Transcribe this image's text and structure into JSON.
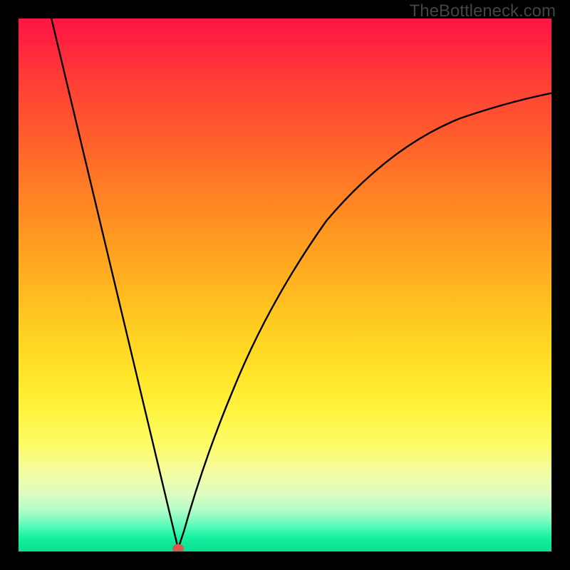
{
  "watermark": "TheBottleneck.com",
  "chart_data": {
    "type": "line",
    "title": "",
    "xlabel": "",
    "ylabel": "",
    "xlim": [
      0,
      100
    ],
    "ylim": [
      0,
      100
    ],
    "curve_description": "V-shaped bottleneck curve. Left branch descends linearly from top-left to the minimum. Right branch rises with diminishing slope toward the right edge.",
    "minimum_point": {
      "x": 30,
      "y": 0
    },
    "left_branch": [
      {
        "x": 6,
        "y": 100
      },
      {
        "x": 30,
        "y": 0
      }
    ],
    "right_branch": [
      {
        "x": 30,
        "y": 0
      },
      {
        "x": 34,
        "y": 12
      },
      {
        "x": 40,
        "y": 30
      },
      {
        "x": 48,
        "y": 48
      },
      {
        "x": 58,
        "y": 62
      },
      {
        "x": 70,
        "y": 72
      },
      {
        "x": 82,
        "y": 79
      },
      {
        "x": 92,
        "y": 83
      },
      {
        "x": 100,
        "y": 86
      }
    ],
    "gradient": {
      "top_color": "#ff1744",
      "mid_color": "#ffc820",
      "bottom_color": "#0ce090",
      "description": "Vertical rainbow heat gradient: red at top through orange, yellow, to green at bottom."
    },
    "marker": {
      "x": 30,
      "y": 0,
      "color": "#d75a4a"
    }
  },
  "marker_style": {
    "left_pct": 30,
    "bottom_pct": 0.5
  }
}
